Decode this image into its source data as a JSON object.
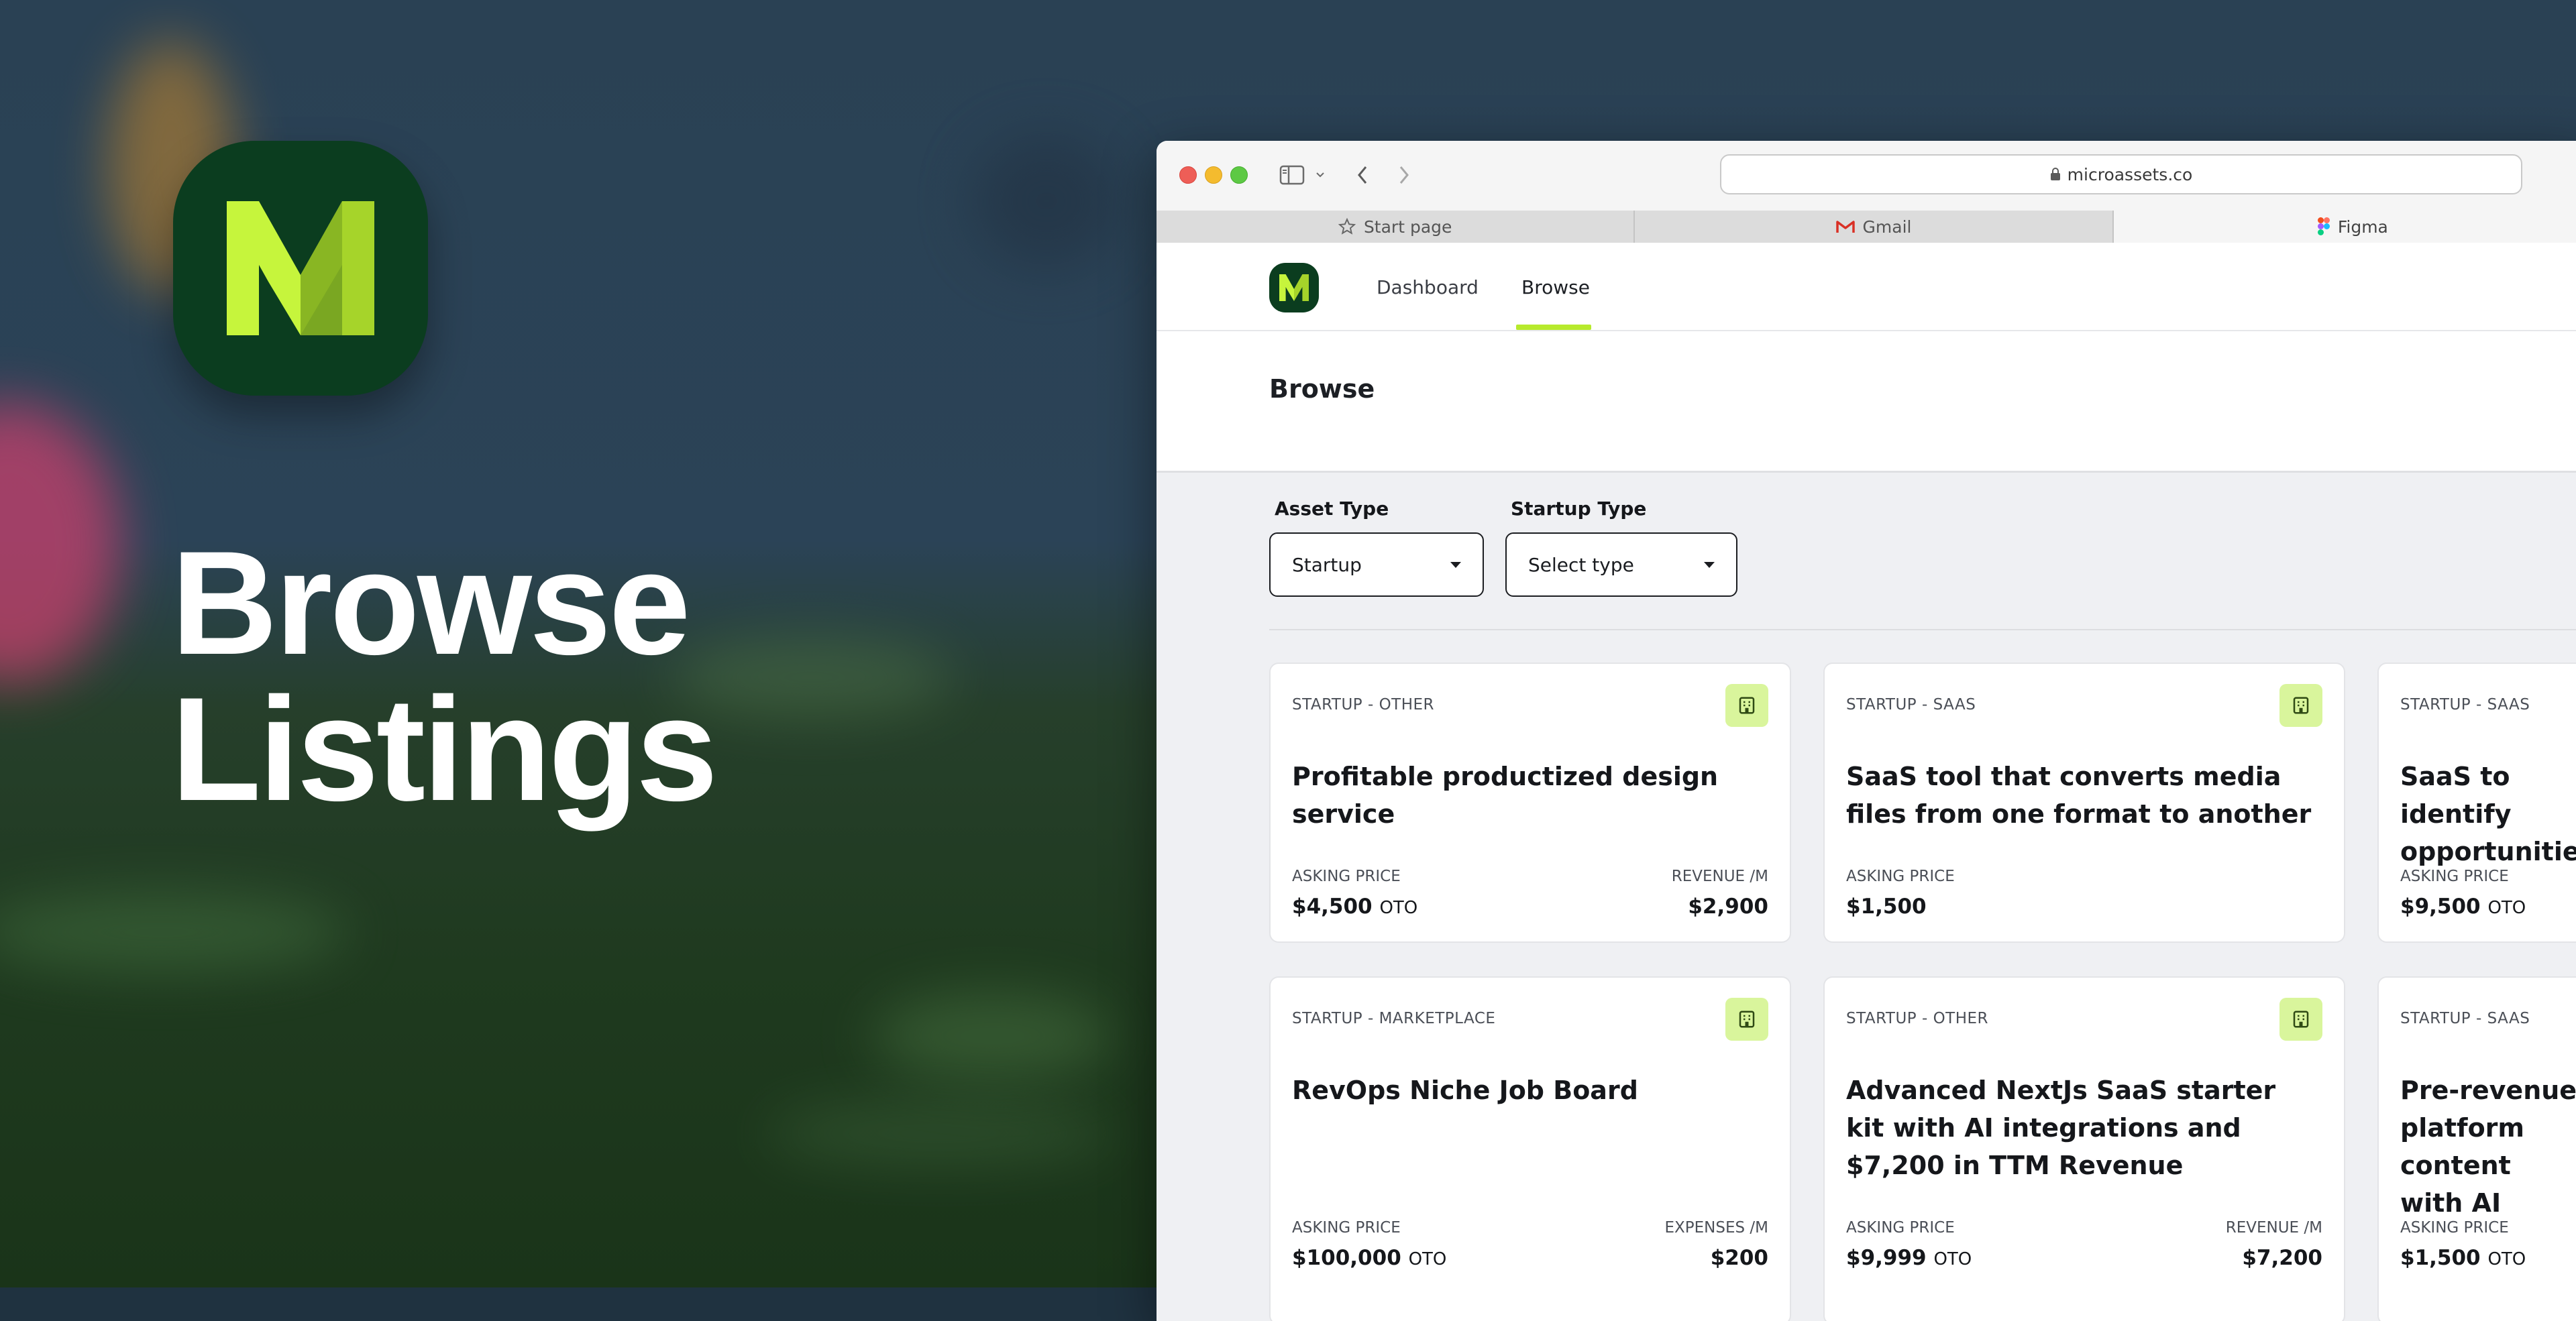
{
  "hero": {
    "line1": "Browse",
    "line2": "Listings"
  },
  "browser": {
    "url": "microassets.co",
    "tabs": [
      {
        "label": "Start page",
        "icon": "star-icon"
      },
      {
        "label": "Gmail",
        "icon": "gmail-icon"
      },
      {
        "label": "Figma",
        "icon": "figma-icon"
      }
    ]
  },
  "app": {
    "nav": {
      "dashboard": "Dashboard",
      "browse": "Browse"
    },
    "page_title": "Browse",
    "filters": {
      "asset_type_label": "Asset Type",
      "asset_type_value": "Startup",
      "startup_type_label": "Startup Type",
      "startup_type_value": "Select type"
    },
    "cards": [
      {
        "category": "STARTUP - OTHER",
        "title": "Profitable productized design service",
        "asking_label": "ASKING PRICE",
        "asking_value": "$4,500",
        "asking_suffix": "OTO",
        "metric_label": "REVENUE /M",
        "metric_value": "$2,900"
      },
      {
        "category": "STARTUP - SAAS",
        "title": "SaaS tool that converts media files from one format to another",
        "asking_label": "ASKING PRICE",
        "asking_value": "$1,500",
        "asking_suffix": "",
        "metric_label": "",
        "metric_value": ""
      },
      {
        "category": "STARTUP - SAAS",
        "title": "SaaS to identify opportunities",
        "asking_label": "ASKING PRICE",
        "asking_value": "$9,500",
        "asking_suffix": "OTO",
        "metric_label": "",
        "metric_value": ""
      },
      {
        "category": "STARTUP - MARKETPLACE",
        "title": "RevOps Niche Job Board",
        "asking_label": "ASKING PRICE",
        "asking_value": "$100,000",
        "asking_suffix": "OTO",
        "metric_label": "EXPENSES /M",
        "metric_value": "$200"
      },
      {
        "category": "STARTUP - OTHER",
        "title": "Advanced NextJs SaaS starter kit with AI integrations and $7,200 in TTM Revenue",
        "asking_label": "ASKING PRICE",
        "asking_value": "$9,999",
        "asking_suffix": "OTO",
        "metric_label": "REVENUE /M",
        "metric_value": "$7,200"
      },
      {
        "category": "STARTUP - SAAS",
        "title": "Pre-revenue platform content with AI",
        "asking_label": "ASKING PRICE",
        "asking_value": "$1,500",
        "asking_suffix": "OTO",
        "metric_label": "",
        "metric_value": ""
      }
    ]
  },
  "colors": {
    "brand_dark": "#0b3d1f",
    "brand_lime": "#b7ea2c",
    "badge_bg": "#d9f59c"
  }
}
